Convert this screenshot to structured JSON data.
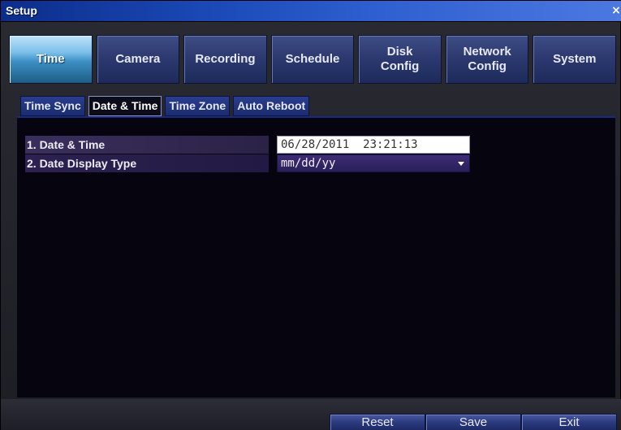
{
  "window": {
    "title": "Setup",
    "close_glyph": "×"
  },
  "main_tabs": [
    {
      "label": "Time",
      "active": true
    },
    {
      "label": "Camera",
      "active": false
    },
    {
      "label": "Recording",
      "active": false
    },
    {
      "label": "Schedule",
      "active": false
    },
    {
      "label": "Disk\nConfig",
      "active": false
    },
    {
      "label": "Network\nConfig",
      "active": false
    },
    {
      "label": "System",
      "active": false
    }
  ],
  "sub_tabs": [
    {
      "label": "Time Sync",
      "active": false
    },
    {
      "label": "Date & Time",
      "active": true
    },
    {
      "label": "Time Zone",
      "active": false
    },
    {
      "label": "Auto Reboot",
      "active": false
    }
  ],
  "settings": {
    "date_time": {
      "label": "1. Date & Time",
      "value": "06/28/2011  23:21:13"
    },
    "date_display_type": {
      "label": "2. Date Display Type",
      "value": "mm/dd/yy",
      "icon": "chevron-down-icon"
    }
  },
  "buttons": {
    "reset": "Reset",
    "save": "Save",
    "exit": "Exit"
  },
  "colors": {
    "title_bar": "#1b4ab8",
    "active_tab": "#7cc0ea",
    "tab": "#2c3a70",
    "panel_background": "#05040f"
  }
}
